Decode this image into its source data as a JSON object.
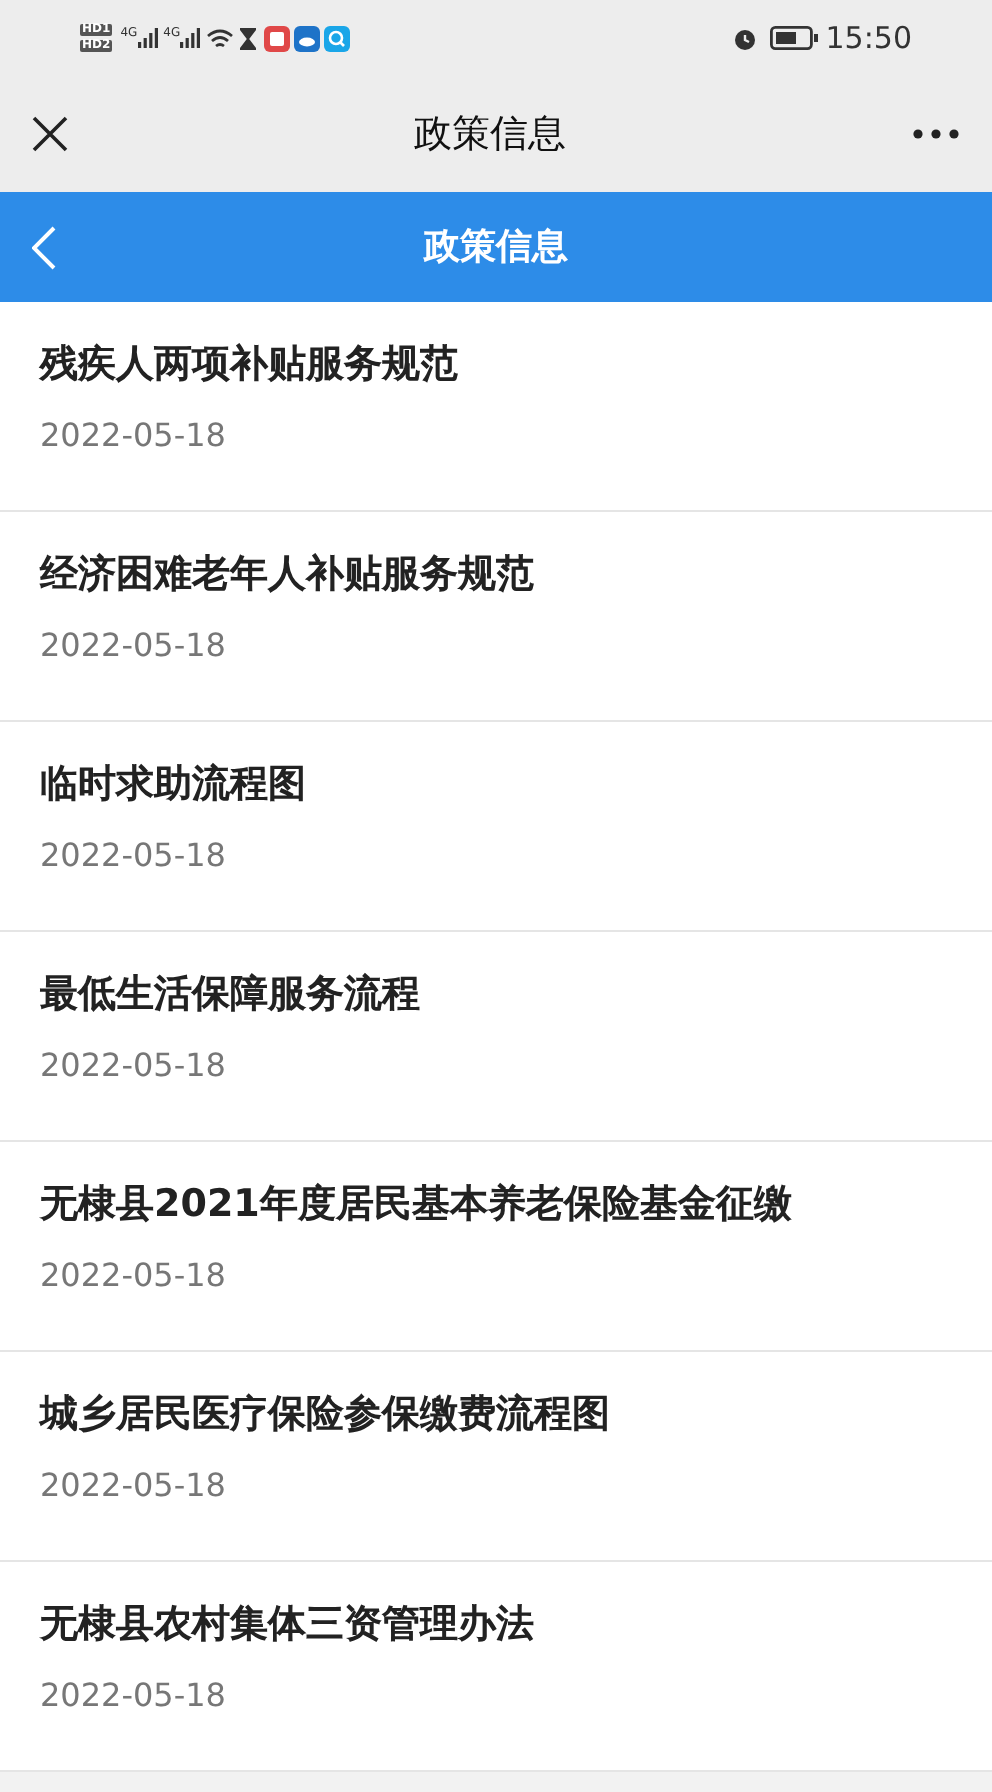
{
  "status_bar": {
    "sims": [
      "HD1",
      "HD2"
    ],
    "networks": [
      "4G",
      "4G"
    ],
    "time": "15:50"
  },
  "browser_bar": {
    "title": "政策信息"
  },
  "header": {
    "title": "政策信息"
  },
  "items": [
    {
      "title": "残疾人两项补贴服务规范",
      "date": "2022-05-18"
    },
    {
      "title": "经济困难老年人补贴服务规范",
      "date": "2022-05-18"
    },
    {
      "title": "临时求助流程图",
      "date": "2022-05-18"
    },
    {
      "title": "最低生活保障服务流程",
      "date": "2022-05-18"
    },
    {
      "title": "无棣县2021年度居民基本养老保险基金征缴",
      "date": "2022-05-18"
    },
    {
      "title": "城乡居民医疗保险参保缴费流程图",
      "date": "2022-05-18"
    },
    {
      "title": "无棣县农村集体三资管理办法",
      "date": "2022-05-18"
    }
  ]
}
